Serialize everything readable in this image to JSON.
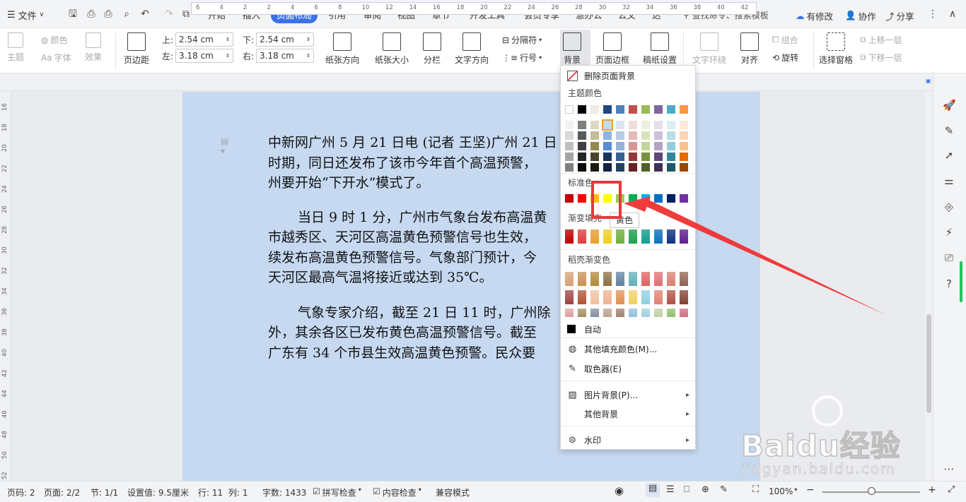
{
  "titlebar": {
    "file_label": "文件",
    "tabs": [
      "开始",
      "插入",
      "页面布局",
      "引用",
      "审阅",
      "视图",
      "章节",
      "开发工具",
      "会员专享",
      "慧办公",
      "公文",
      "达"
    ],
    "active_tab": "页面布局",
    "search_placeholder": "查找命令、搜索模板",
    "right_buttons": [
      "有修改",
      "协作",
      "分享"
    ]
  },
  "ribbon": {
    "theme": "主题",
    "colors": "颜色",
    "font": "字体",
    "effects": "效果",
    "margins": "页边距",
    "top_label": "上:",
    "top_value": "2.54 cm",
    "bottom_label": "下:",
    "bottom_value": "2.54 cm",
    "left_label": "左:",
    "left_value": "3.18 cm",
    "right_label": "右:",
    "right_value": "3.18 cm",
    "orientation": "纸张方向",
    "size": "纸张大小",
    "columns": "分栏",
    "text_direction": "文字方向",
    "breaks": "分隔符",
    "line_numbers": "行号",
    "background": "背景",
    "page_border": "页面边框",
    "manuscript": "稿纸设置",
    "text_wrap": "文字环绕",
    "align": "对齐",
    "group": "组合",
    "rotate": "旋转",
    "selection_pane": "选择窗格",
    "bring_forward": "上移一层",
    "send_backward": "下移一层"
  },
  "ruler": {
    "h_ticks": [
      "6",
      "4",
      "2",
      "2",
      "4",
      "6",
      "8",
      "10",
      "12",
      "14",
      "16",
      "18",
      "20",
      "22",
      "24",
      "26",
      "28",
      "30",
      "32",
      "34",
      "36",
      "38",
      "40",
      "42"
    ],
    "v_ticks": [
      "16",
      "18",
      "20",
      "22",
      "24",
      "26",
      "28",
      "30",
      "32",
      "34",
      "36",
      "38",
      "40",
      "42",
      "44",
      "46",
      "48",
      "50",
      "52"
    ]
  },
  "document": {
    "p1": [
      "中新网广州 5 月 21 日电 (记者 王坚)广州 21 日",
      "时期，同日还发布了该市今年首个高温预警，",
      "州要开始“下开水”模式了。"
    ],
    "p2": [
      "当日 9 时 1 分，广州市气象台发布高温黄",
      "市越秀区、天河区高温黄色预警信号也生效，",
      "续发布高温黄色预警信号。气象部门预计，今",
      "天河区最高气温将接近或达到 35℃。"
    ],
    "p3": [
      "气象专家介绍，截至 21 日 11 时，广州除",
      "外，其余各区已发布黄色高温预警信号。截至",
      "广东有 34 个市县生效高温黄色预警。民众要"
    ]
  },
  "bg_menu": {
    "remove_bg": "删除页面背景",
    "theme_colors": "主题颜色",
    "standard_colors": "标准色",
    "gradient_fill": "渐变填充",
    "docer_gradient": "稻壳渐变色",
    "auto": "自动",
    "more_fill": "其他填充颜色(M)...",
    "eyedropper": "取色器(E)",
    "picture_bg": "图片背景(P)...",
    "other_bg": "其他背景",
    "watermark": "水印",
    "tooltip": "黄色",
    "theme_top_row": [
      "#ffffff",
      "#000000",
      "#eeece1",
      "#1f497d",
      "#4f81bd",
      "#c0504d",
      "#9bbb59",
      "#8064a2",
      "#4bacc6",
      "#f79646"
    ],
    "theme_shades": [
      [
        "#f2f2f2",
        "#7f7f7f",
        "#ddd9c3",
        "#c6d9f0",
        "#dbe5f1",
        "#f2dcdb",
        "#ebf1dd",
        "#e5e0ec",
        "#dbeef3",
        "#fdeada"
      ],
      [
        "#d8d8d8",
        "#595959",
        "#c4bd97",
        "#8db3e2",
        "#b8cce4",
        "#e5b9b7",
        "#d7e3bc",
        "#ccc1d9",
        "#b7dde8",
        "#fbd5b5"
      ],
      [
        "#bfbfbf",
        "#3f3f3f",
        "#938953",
        "#548dd4",
        "#95b3d7",
        "#d99694",
        "#c3d69b",
        "#b2a2c7",
        "#92cddc",
        "#fac08f"
      ],
      [
        "#a5a5a5",
        "#262626",
        "#494429",
        "#17365d",
        "#366092",
        "#953734",
        "#76923c",
        "#5f497a",
        "#31859b",
        "#e36c09"
      ],
      [
        "#7f7f7f",
        "#0c0c0c",
        "#1d1b10",
        "#0f243e",
        "#244061",
        "#632423",
        "#4f6128",
        "#3f3151",
        "#205867",
        "#974806"
      ]
    ],
    "standard": [
      "#c00000",
      "#ff0000",
      "#ffc000",
      "#ffff00",
      "#92d050",
      "#00b050",
      "#00b0f0",
      "#0070c0",
      "#002060",
      "#7030a0"
    ],
    "gradient": [
      "#c00000",
      "#e04040",
      "#e8a030",
      "#f0d020",
      "#70b040",
      "#20a050",
      "#10a090",
      "#1070c0",
      "#103080",
      "#602090"
    ],
    "docer": [
      [
        "#d8a070",
        "#c89050",
        "#b08838",
        "#8a7040",
        "#6080a0",
        "#60b0b8",
        "#e06060",
        "#e07070",
        "#d88070",
        "#906050"
      ],
      [
        "#a04040",
        "#b05030",
        "#f0c0a0",
        "#f0b090",
        "#e09050",
        "#f0d060",
        "#90d0e0",
        "#e08070",
        "#b05040",
        "#804030"
      ],
      [
        "#e0a0a0",
        "#a09060",
        "#8090a0",
        "#c0a090",
        "#a08070",
        "#90c0e0",
        "#a0d0e0",
        "#c0d0a0",
        "#90c070",
        "#d07080"
      ]
    ]
  },
  "status": {
    "page_code": "页码: 2",
    "pages": "页面: 2/2",
    "section": "节: 1/1",
    "setting": "设置值: 9.5厘米",
    "row": "行: 11",
    "col": "列: 1",
    "words": "字数: 1433",
    "spell": "拼写检查",
    "content_check": "内容检查",
    "compat": "兼容模式",
    "zoom": "100%"
  },
  "watermark": {
    "brand": "Baidu经验",
    "url": "jingyan.baidu.com"
  }
}
